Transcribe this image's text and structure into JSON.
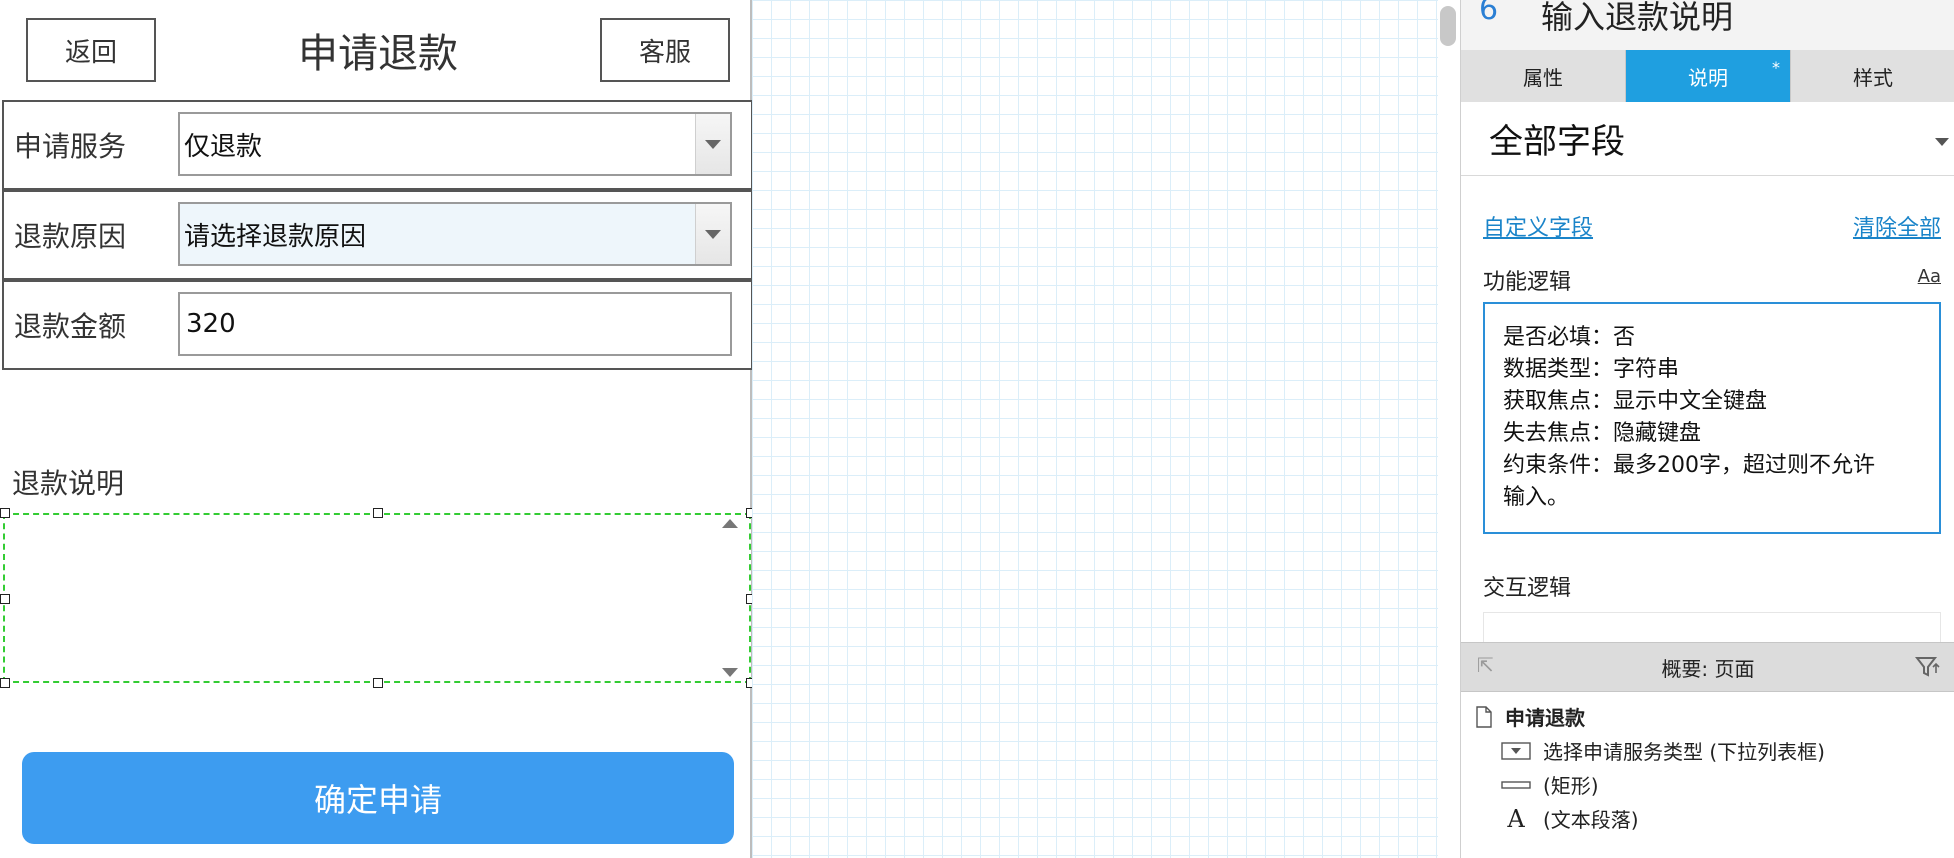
{
  "prototype": {
    "back_label": "返回",
    "title": "申请退款",
    "service_label": "客服",
    "rows": [
      {
        "label": "申请服务",
        "value": "仅退款",
        "type": "select"
      },
      {
        "label": "退款原因",
        "value": "请选择退款原因",
        "type": "select"
      },
      {
        "label": "退款金额",
        "value": "320",
        "type": "text"
      }
    ],
    "description_label": "退款说明",
    "description_value": "",
    "confirm_label": "确定申请"
  },
  "panel": {
    "widget_number": "6",
    "widget_name": "输入退款说明",
    "tabs": [
      {
        "label": "属性",
        "active": false
      },
      {
        "label": "说明",
        "active": true,
        "marker": "*"
      },
      {
        "label": "样式",
        "active": false
      }
    ],
    "fieldset": "全部字段",
    "custom_fields_link": "自定义字段",
    "clear_all_link": "清除全部",
    "logic_label": "功能逻辑",
    "font_icon_label": "Aa",
    "logic_lines": [
      "是否必填：否",
      "数据类型：字符串",
      "获取焦点：显示中文全键盘",
      "失去焦点：隐藏键盘",
      "约束条件：最多200字，超过则不允许",
      "输入。"
    ],
    "interaction_label": "交互逻辑"
  },
  "outline": {
    "title": "概要: 页面",
    "items": [
      {
        "label": "申请退款",
        "icon": "page-icon"
      },
      {
        "label": "选择申请服务类型 (下拉列表框)",
        "icon": "dropdown-icon"
      },
      {
        "label": "(矩形)",
        "icon": "rectangle-icon"
      },
      {
        "label": "(文本段落)",
        "icon": "text-icon"
      }
    ]
  },
  "colors": {
    "accent_blue": "#3d9cf0",
    "tab_active": "#1f9fe0",
    "link": "#1a84c9",
    "selection": "#33cc33"
  }
}
